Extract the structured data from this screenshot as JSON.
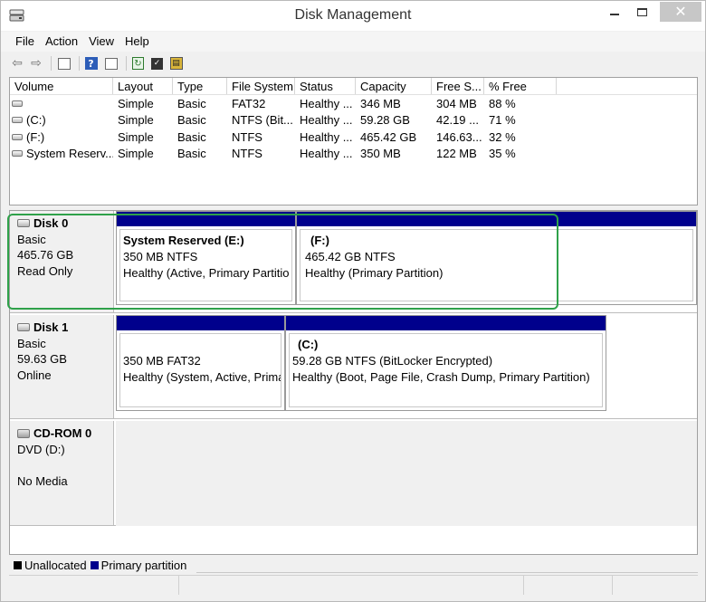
{
  "window": {
    "title": "Disk Management",
    "close_glyph": "✕"
  },
  "menu": [
    "File",
    "Action",
    "View",
    "Help"
  ],
  "toolbar": {
    "back_glyph": "⇦",
    "forward_glyph": "⇨",
    "help_glyph": "?"
  },
  "volume_list": {
    "headers": [
      "Volume",
      "Layout",
      "Type",
      "File System",
      "Status",
      "Capacity",
      "Free S...",
      "% Free"
    ],
    "rows": [
      {
        "volume": "",
        "layout": "Simple",
        "type": "Basic",
        "fs": "FAT32",
        "status": "Healthy ...",
        "capacity": "346 MB",
        "free": "304 MB",
        "pct": "88 %"
      },
      {
        "volume": "(C:)",
        "layout": "Simple",
        "type": "Basic",
        "fs": "NTFS (Bit...",
        "status": "Healthy ...",
        "capacity": "59.28 GB",
        "free": "42.19 ...",
        "pct": "71 %"
      },
      {
        "volume": "(F:)",
        "layout": "Simple",
        "type": "Basic",
        "fs": "NTFS",
        "status": "Healthy ...",
        "capacity": "465.42 GB",
        "free": "146.63...",
        "pct": "32 %"
      },
      {
        "volume": "System Reserv...",
        "layout": "Simple",
        "type": "Basic",
        "fs": "NTFS",
        "status": "Healthy ...",
        "capacity": "350 MB",
        "free": "122 MB",
        "pct": "35 %"
      }
    ]
  },
  "disks": [
    {
      "name": "Disk 0",
      "lines": [
        "Basic",
        "465.76 GB",
        "Read Only"
      ],
      "partitions": [
        {
          "name": "System Reserved  (E:)",
          "size": "350 MB NTFS",
          "status": "Healthy (Active, Primary Partitio"
        },
        {
          "name": "(F:)",
          "size": "465.42 GB NTFS",
          "status": "Healthy (Primary Partition)"
        }
      ]
    },
    {
      "name": "Disk 1",
      "lines": [
        "Basic",
        "59.63 GB",
        "Online"
      ],
      "partitions": [
        {
          "name": "",
          "size": "350 MB FAT32",
          "status": "Healthy (System, Active, Prima"
        },
        {
          "name": "(C:)",
          "size": "59.28 GB NTFS (BitLocker Encrypted)",
          "status": "Healthy (Boot, Page File, Crash Dump, Primary Partition)"
        }
      ]
    },
    {
      "name": "CD-ROM 0",
      "lines": [
        "DVD (D:)",
        "",
        "No Media"
      ]
    }
  ],
  "legend": {
    "items": [
      {
        "label": "Unallocated",
        "color": "#000000"
      },
      {
        "label": "Primary partition",
        "color": "#00008c"
      }
    ]
  },
  "colors": {
    "primary_partition": "#00008c",
    "highlight": "#2fa14a"
  }
}
